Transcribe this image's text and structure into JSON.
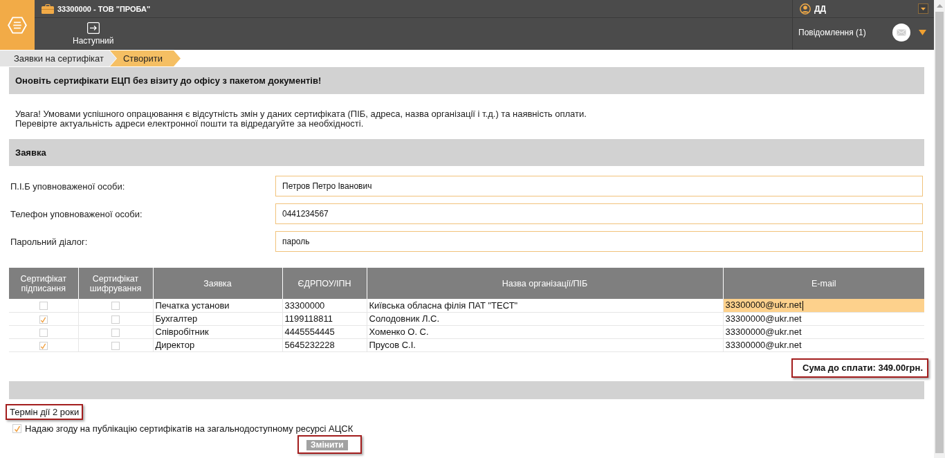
{
  "header": {
    "organization": "33300000 - ТОВ \"ПРОБА\"",
    "next_button": "Наступний",
    "user": "ДД",
    "notifications": "Повідомлення (1)"
  },
  "breadcrumbs": [
    {
      "label": "Заявки на сертифікат",
      "selected": false
    },
    {
      "label": "Створити",
      "selected": true
    }
  ],
  "banner": "Оновіть сертифікати ЕЦП без візиту до офісу з пакетом документів!",
  "notice": [
    "Увага! Умовами успішного опрацювання є відсутність змін у даних сертифіката (ПІБ, адреса, назва організації і т.д.) та наявність оплати.",
    "Перевірте актуальність адреси електронної пошти та відредагуйте за необхідності."
  ],
  "section_title": "Заявка",
  "form": [
    {
      "label": "П.І.Б уповноваженої особи:",
      "value": "Петров Петро Іванович"
    },
    {
      "label": "Телефон уповноваженої особи:",
      "value": "0441234567"
    },
    {
      "label": "Парольний діалог:",
      "value": "пароль"
    }
  ],
  "table": {
    "columns": [
      "Сертифікат підписання",
      "Сертифікат шифрування",
      "Заявка",
      "ЄДРПОУ/ІПН",
      "Назва організації/ПІБ",
      "E-mail"
    ],
    "rows": [
      {
        "signing": false,
        "encryption": false,
        "request": "Печатка установи",
        "code": "33300000",
        "name": "Київська обласна філія ПАТ \"ТЕСТ\"",
        "email": "33300000@ukr.net",
        "focused": true
      },
      {
        "signing": true,
        "encryption": false,
        "request": "Бухгалтер",
        "code": "1199118811",
        "name": "Солодовник Л.С.",
        "email": "33300000@ukr.net",
        "focused": false
      },
      {
        "signing": false,
        "encryption": false,
        "request": "Співробітник",
        "code": "4445554445",
        "name": "Хоменко О. С.",
        "email": "33300000@ukr.net",
        "focused": false
      },
      {
        "signing": true,
        "encryption": false,
        "request": "Директор",
        "code": "5645232228",
        "name": "Прусов С.І.",
        "email": "33300000@ukr.net",
        "focused": false
      }
    ]
  },
  "total": {
    "text": "Сума до сплати: 349.00грн.",
    "highlighted": true
  },
  "term": {
    "text": "Термін дії 2 роки",
    "highlighted": true
  },
  "consent": {
    "label": "Надаю згоду на публікацію сертифікатів на загальнодоступному ресурсі АЦСК",
    "checked": true
  },
  "submit": {
    "label": "Змінити",
    "disabled": true,
    "highlighted": true
  }
}
